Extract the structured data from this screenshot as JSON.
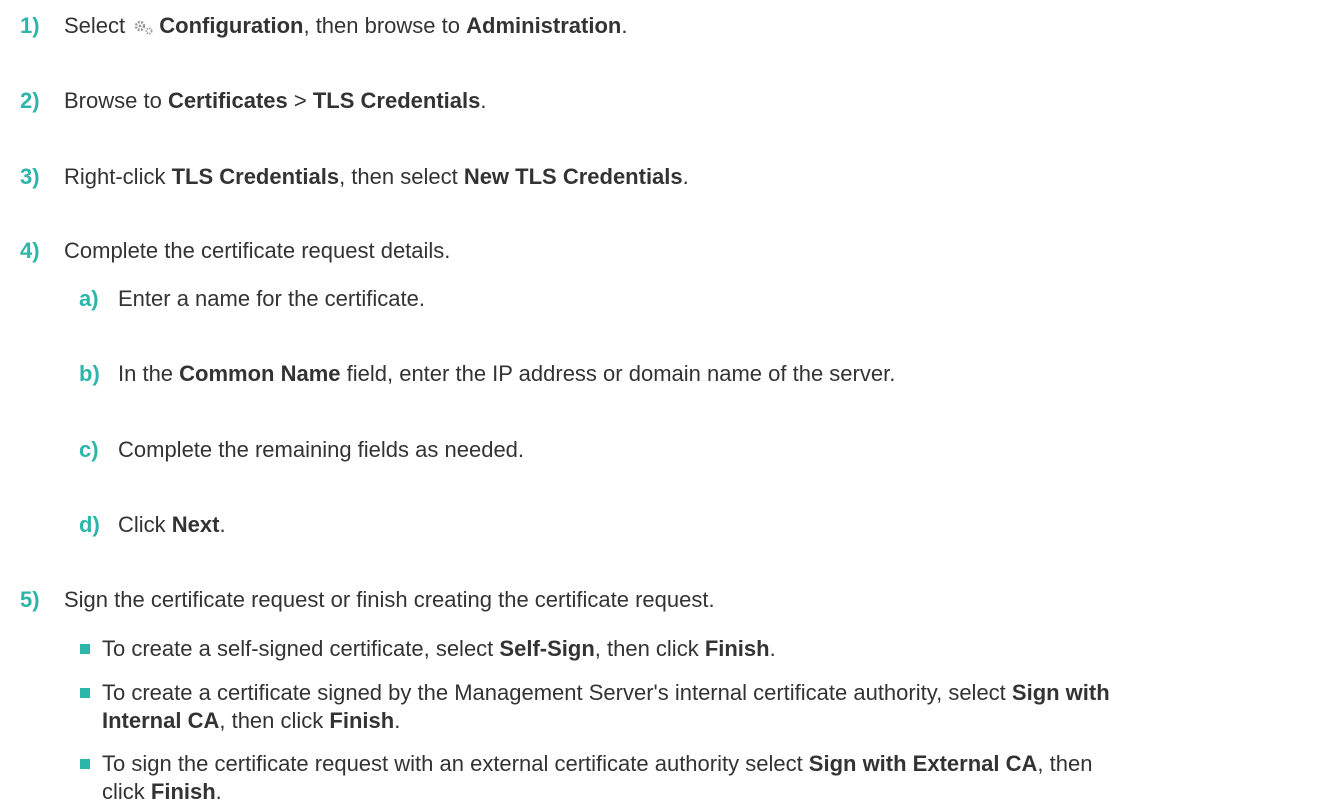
{
  "steps": [
    {
      "num": "1)",
      "p": [
        "Select ",
        "Configuration",
        ", then browse to ",
        "Administration",
        "."
      ]
    },
    {
      "num": "2)",
      "p": [
        "Browse to ",
        "Certificates",
        " > ",
        "TLS Credentials",
        "."
      ]
    },
    {
      "num": "3)",
      "p": [
        "Right-click ",
        "TLS Credentials",
        ", then select ",
        "New TLS Credentials",
        "."
      ]
    },
    {
      "num": "4)",
      "text": "Complete the certificate request details."
    },
    {
      "num": "5)",
      "text": "Sign the certificate request or finish creating the certificate request."
    }
  ],
  "substeps": [
    {
      "num": "a)",
      "text": "Enter a name for the certificate."
    },
    {
      "num": "b)",
      "p": [
        "In the ",
        "Common Name",
        " field, enter the IP address or domain name of the server."
      ]
    },
    {
      "num": "c)",
      "text": "Complete the remaining fields as needed."
    },
    {
      "num": "d)",
      "p": [
        "Click ",
        "Next",
        "."
      ]
    }
  ],
  "bullets": [
    {
      "p": [
        "To create a self-signed certificate, select ",
        "Self-Sign",
        ", then click ",
        "Finish",
        "."
      ]
    },
    {
      "l1": [
        "To create a certificate signed by the Management Server's internal certificate authority, select ",
        "Sign with"
      ],
      "l2": [
        "Internal CA",
        ", then click ",
        "Finish",
        "."
      ]
    },
    {
      "l1": [
        "To sign the certificate request with an external certificate authority select ",
        "Sign with External CA",
        ", then"
      ],
      "l2": [
        "click ",
        "Finish",
        "."
      ]
    }
  ],
  "icons": {
    "gear": "gears-icon"
  },
  "colors": {
    "accent": "#2cb5a9",
    "text": "#333333"
  }
}
